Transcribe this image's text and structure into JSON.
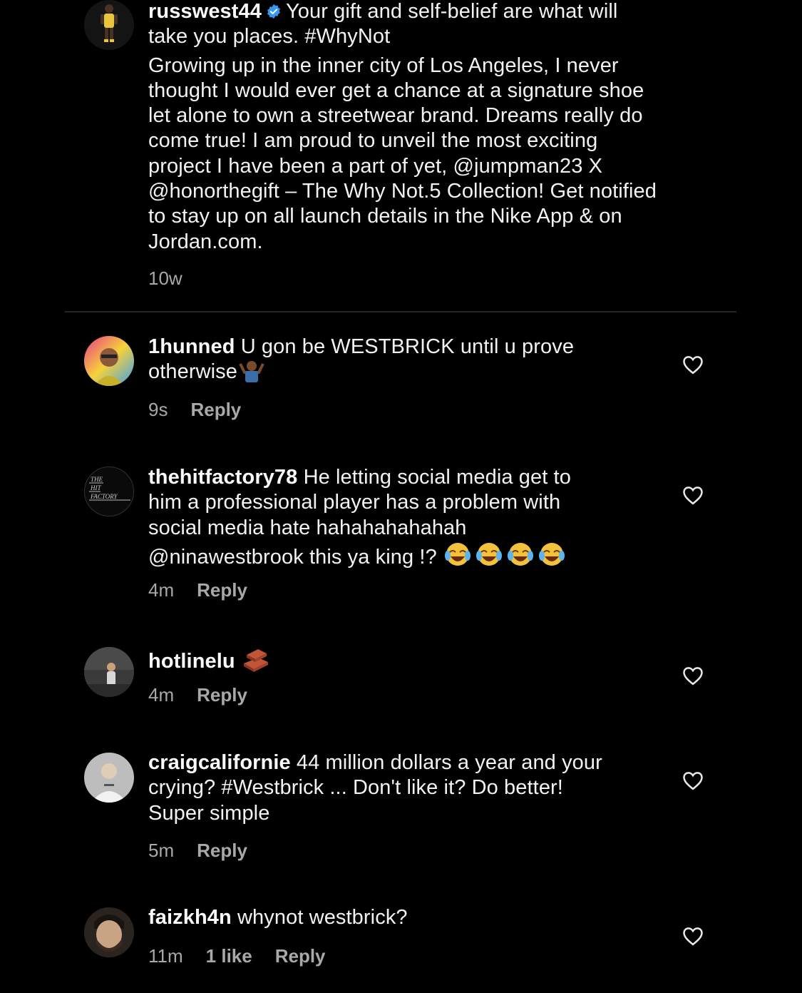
{
  "caption": {
    "username": "russwest44",
    "line1_rest": "Your gift and self-belief are what will",
    "line2": "take you places. #WhyNot",
    "body_lines": [
      "Growing up in the inner city of Los Angeles, I never",
      "thought I would ever get a chance at a signature shoe",
      "let alone to own a streetwear brand. Dreams really do",
      "come true! I am proud to unveil the most exciting",
      "project I have been a part of yet, @jumpman23 X",
      "@honorthegift – The Why Not.5 Collection! Get notified",
      "to stay up on all launch details in the Nike App & on",
      "Jordan.com."
    ],
    "time": "10w",
    "verified_icon": "verified-badge-icon",
    "accent_color": "#3897f0"
  },
  "comments": [
    {
      "username": "1hunned",
      "lines": [
        "U gon be WESTBRICK until u prove",
        "otherwise"
      ],
      "emoji": "person-shrugging",
      "time": "9s",
      "reply": "Reply"
    },
    {
      "username": "thehitfactory78",
      "lines": [
        "He letting social media get to",
        "him a professional player has a problem with",
        "social media hate hahahahahahah",
        "@ninawestbrook this ya king !?"
      ],
      "emoji": "tears-of-joy x4",
      "time": "4m",
      "reply": "Reply"
    },
    {
      "username": "hotlinelu",
      "lines": [],
      "emoji": "brick",
      "time": "4m",
      "reply": "Reply"
    },
    {
      "username": "craigcalifornie",
      "lines": [
        "44 million dollars a year and your",
        "crying? #Westbrick ... Don't like it? Do better!",
        "Super simple"
      ],
      "time": "5m",
      "reply": "Reply"
    },
    {
      "username": "faizkh4n",
      "lines": [
        "whynot westbrick?"
      ],
      "time": "11m",
      "likes": "1 like",
      "reply": "Reply"
    }
  ],
  "avatar_labels": {
    "hitfactory": [
      "THE",
      "HIT",
      "FACTORY"
    ]
  }
}
